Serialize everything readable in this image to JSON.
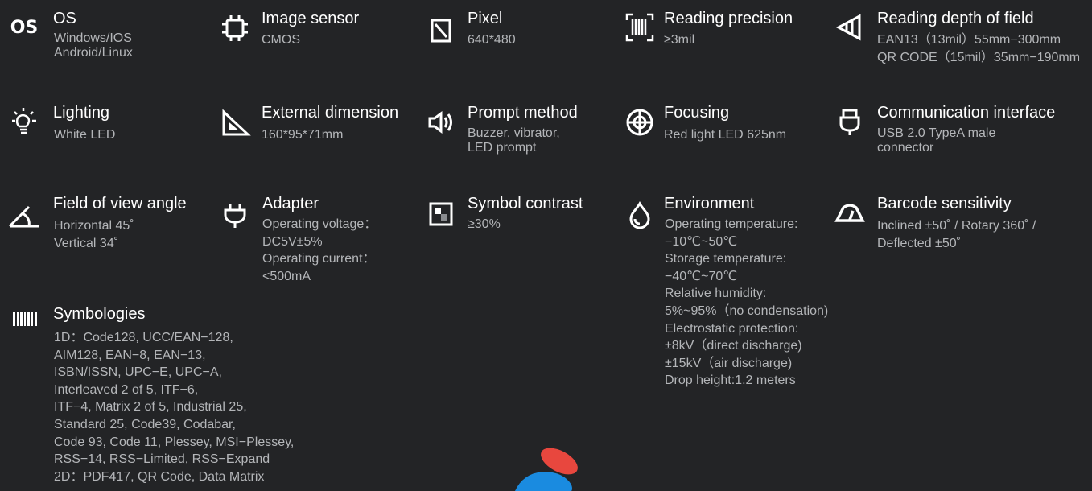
{
  "specs": {
    "os": {
      "icon": "os-text-icon",
      "icon_text": "OS",
      "title": "OS",
      "lines": [
        "Windows/IOS",
        "Android/Linux"
      ]
    },
    "image_sensor": {
      "icon": "chip-icon",
      "title": "Image sensor",
      "lines": [
        "CMOS"
      ]
    },
    "pixel": {
      "icon": "pixel-square-icon",
      "title": "Pixel",
      "lines": [
        "640*480"
      ]
    },
    "reading_precision": {
      "icon": "barcode-scan-icon",
      "title": "Reading precision",
      "lines": [
        "≥3mil"
      ]
    },
    "reading_depth": {
      "icon": "depth-of-field-icon",
      "title": "Reading depth of field",
      "lines": [
        "EAN13（13mil）55mm−300mm",
        "QR CODE（15mil）35mm−190mm"
      ]
    },
    "lighting": {
      "icon": "light-bulb-icon",
      "title": "Lighting",
      "lines": [
        "White LED"
      ]
    },
    "external_dimension": {
      "icon": "ruler-triangle-icon",
      "title": "External dimension",
      "lines": [
        "160*95*71mm"
      ]
    },
    "prompt_method": {
      "icon": "speaker-icon",
      "title": "Prompt method",
      "lines": [
        "Buzzer, vibrator,",
        "LED prompt"
      ]
    },
    "focusing": {
      "icon": "target-icon",
      "title": "Focusing",
      "lines": [
        "Red light LED 625nm"
      ]
    },
    "communication_interface": {
      "icon": "usb-plug-icon",
      "title": "Communication interface",
      "lines": [
        "USB 2.0 TypeA male",
        "connector"
      ]
    },
    "field_of_view": {
      "icon": "angle-icon",
      "title": "Field of view angle",
      "lines": [
        "Horizontal 45˚",
        "Vertical 34˚"
      ]
    },
    "adapter": {
      "icon": "power-plug-icon",
      "title": "Adapter",
      "lines": [
        "Operating voltage：",
        "DC5V±5%",
        "Operating current：",
        "<500mA"
      ]
    },
    "symbol_contrast": {
      "icon": "contrast-icon",
      "title": "Symbol contrast",
      "lines": [
        "≥30%"
      ]
    },
    "environment": {
      "icon": "water-drop-icon",
      "title": "Environment",
      "lines": [
        "Operating temperature:",
        "−10℃~50℃",
        "Storage temperature:",
        "−40℃~70℃",
        "Relative humidity:",
        "5%~95%（no condensation)",
        "Electrostatic protection:",
        "±8kV（direct discharge)",
        "±15kV（air discharge)",
        "Drop height:1.2 meters"
      ]
    },
    "barcode_sensitivity": {
      "icon": "gauge-icon",
      "title": "Barcode sensitivity",
      "lines": [
        "Inclined ±50˚ / Rotary 360˚ /",
        "Deflected ±50˚"
      ]
    },
    "symbologies": {
      "icon": "barcode-icon",
      "title": "Symbologies",
      "lines": [
        "1D：Code128, UCC/EAN−128,",
        "AIM128, EAN−8, EAN−13,",
        "ISBN/ISSN, UPC−E, UPC−A,",
        "Interleaved 2 of 5, ITF−6,",
        "ITF−4, Matrix 2 of 5, Industrial 25,",
        "Standard 25, Code39, Codabar,",
        "Code 93, Code 11, Plessey, MSI−Plessey,",
        "RSS−14, RSS−Limited, RSS−Expand",
        "2D：PDF417,  QR Code,  Data Matrix"
      ]
    }
  },
  "colors": {
    "background": "#232426",
    "title": "#ffffff",
    "body_text": "#b4b6b9",
    "logo_red": "#e8473e",
    "logo_blue": "#1a8be0"
  }
}
